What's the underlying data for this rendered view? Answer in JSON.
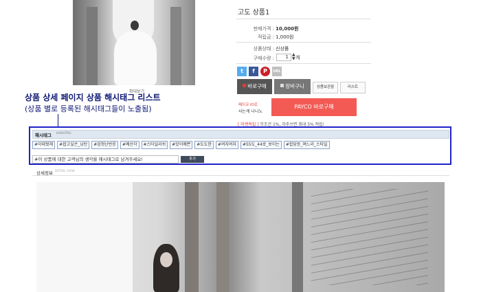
{
  "product_image": {
    "zoom_label": "확대보기"
  },
  "product": {
    "title": "고도 상품1",
    "price_label": "판매가격 :",
    "price_value": "10,000원",
    "points_label": "적립금 :",
    "points_value": "1,000원",
    "status_label": "상품상태 :",
    "status_value": "신상품",
    "qty_label": "구매수량 :",
    "qty_value": "1",
    "qty_unit": "개"
  },
  "sns": [
    {
      "name": "twitter",
      "glyph": "t",
      "color": "#55acee"
    },
    {
      "name": "facebook",
      "glyph": "f",
      "color": "#3b5998"
    },
    {
      "name": "pinterest",
      "glyph": "P",
      "color": "#cb2027"
    },
    {
      "name": "url",
      "glyph": "URL",
      "color": "#bfbfbf"
    }
  ],
  "buttons": {
    "buy_now": "바로구매",
    "cart": "장바구니",
    "wishlist": "상품보관함",
    "list": "리스트"
  },
  "payco": {
    "desc_line1": "페이코 ID로",
    "desc_line2": "사는게 나니노",
    "button": "PAYCO 바로구매"
  },
  "point_note": {
    "highlight": "[ 마켓적립 ]",
    "text": " 무조건 1%, 자주쓰면 최대 5% 적립!"
  },
  "annotation": {
    "title": "상품 상세 페이지 상품 해시태그 리스트",
    "subtitle": "(상품 별로 등록된 해시태그들이 노출됨)"
  },
  "hashtag": {
    "title": "해시태그",
    "subtitle": "HASHTAG",
    "tags": [
      "#이태헛해",
      "#잡고싶은_닝탄",
      "#엄청난반응",
      "#예산각",
      "#스타일리쉬",
      "#맛이예쁜",
      "#도도한",
      "#여자여자",
      "#55도_44로_보이는",
      "#합당등_며느리_스타일"
    ],
    "input_value": "#이 상품에 대한 고객님의 생각을 해시태그로 남겨주세요!",
    "submit": "추가"
  },
  "detail": {
    "title": "상세정보",
    "subtitle": "DETAIL VIEW"
  },
  "colors": {
    "annotation": "#0e1873",
    "highlight_border": "#1e22c8",
    "payco": "#f35a54"
  }
}
